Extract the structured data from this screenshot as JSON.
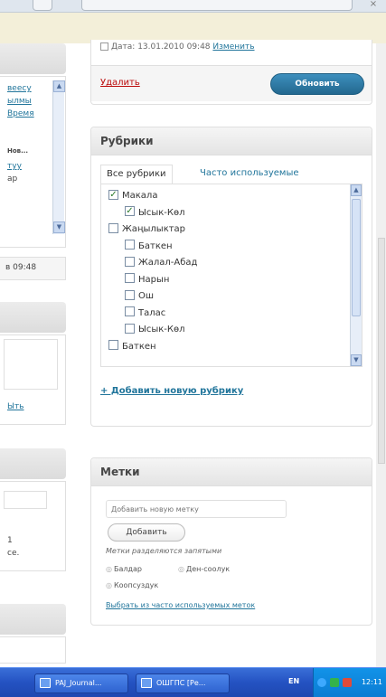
{
  "publish": {
    "date_label": "Дата: 13.01.2010 09:48",
    "edit_link": "Изменить",
    "delete_label": "Удалить",
    "update_label": "Обновить"
  },
  "left": {
    "links": [
      "веесу",
      "ылмы",
      "Время",
      "туу",
      "ар"
    ],
    "label_small": "Нов...",
    "time_text": "в 09:48",
    "link_short": "Ыть",
    "text_a": "1",
    "text_b": "се."
  },
  "categories": {
    "title": "Рубрики",
    "tab_all": "Все рубрики",
    "tab_popular": "Часто используемые",
    "items": [
      {
        "label": "Макала",
        "checked": true,
        "level": 0
      },
      {
        "label": "Ысык-Көл",
        "checked": true,
        "level": 1
      },
      {
        "label": "Жаңылыктар",
        "checked": false,
        "level": 0
      },
      {
        "label": "Баткен",
        "checked": false,
        "level": 1
      },
      {
        "label": "Жалал-Абад",
        "checked": false,
        "level": 1
      },
      {
        "label": "Нарын",
        "checked": false,
        "level": 1
      },
      {
        "label": "Ош",
        "checked": false,
        "level": 1
      },
      {
        "label": "Талас",
        "checked": false,
        "level": 1
      },
      {
        "label": "Ысык-Көл",
        "checked": false,
        "level": 1
      },
      {
        "label": "Баткен",
        "checked": false,
        "level": 0
      }
    ],
    "add_link": "+ Добавить новую рубрику"
  },
  "tags": {
    "title": "Метки",
    "input_placeholder": "Добавить новую метку",
    "add_button": "Добавить",
    "hint": "Метки разделяются запятыми",
    "chips": [
      "Балдар",
      "Ден-соолук",
      "Коопсуздук"
    ],
    "choose_link": "Выбрать из часто используемых меток"
  },
  "taskbar": {
    "buttons": [
      "PAJ_Journal...",
      "ОШГПС [Ре..."
    ],
    "lang": "EN",
    "clock": "12:11"
  }
}
